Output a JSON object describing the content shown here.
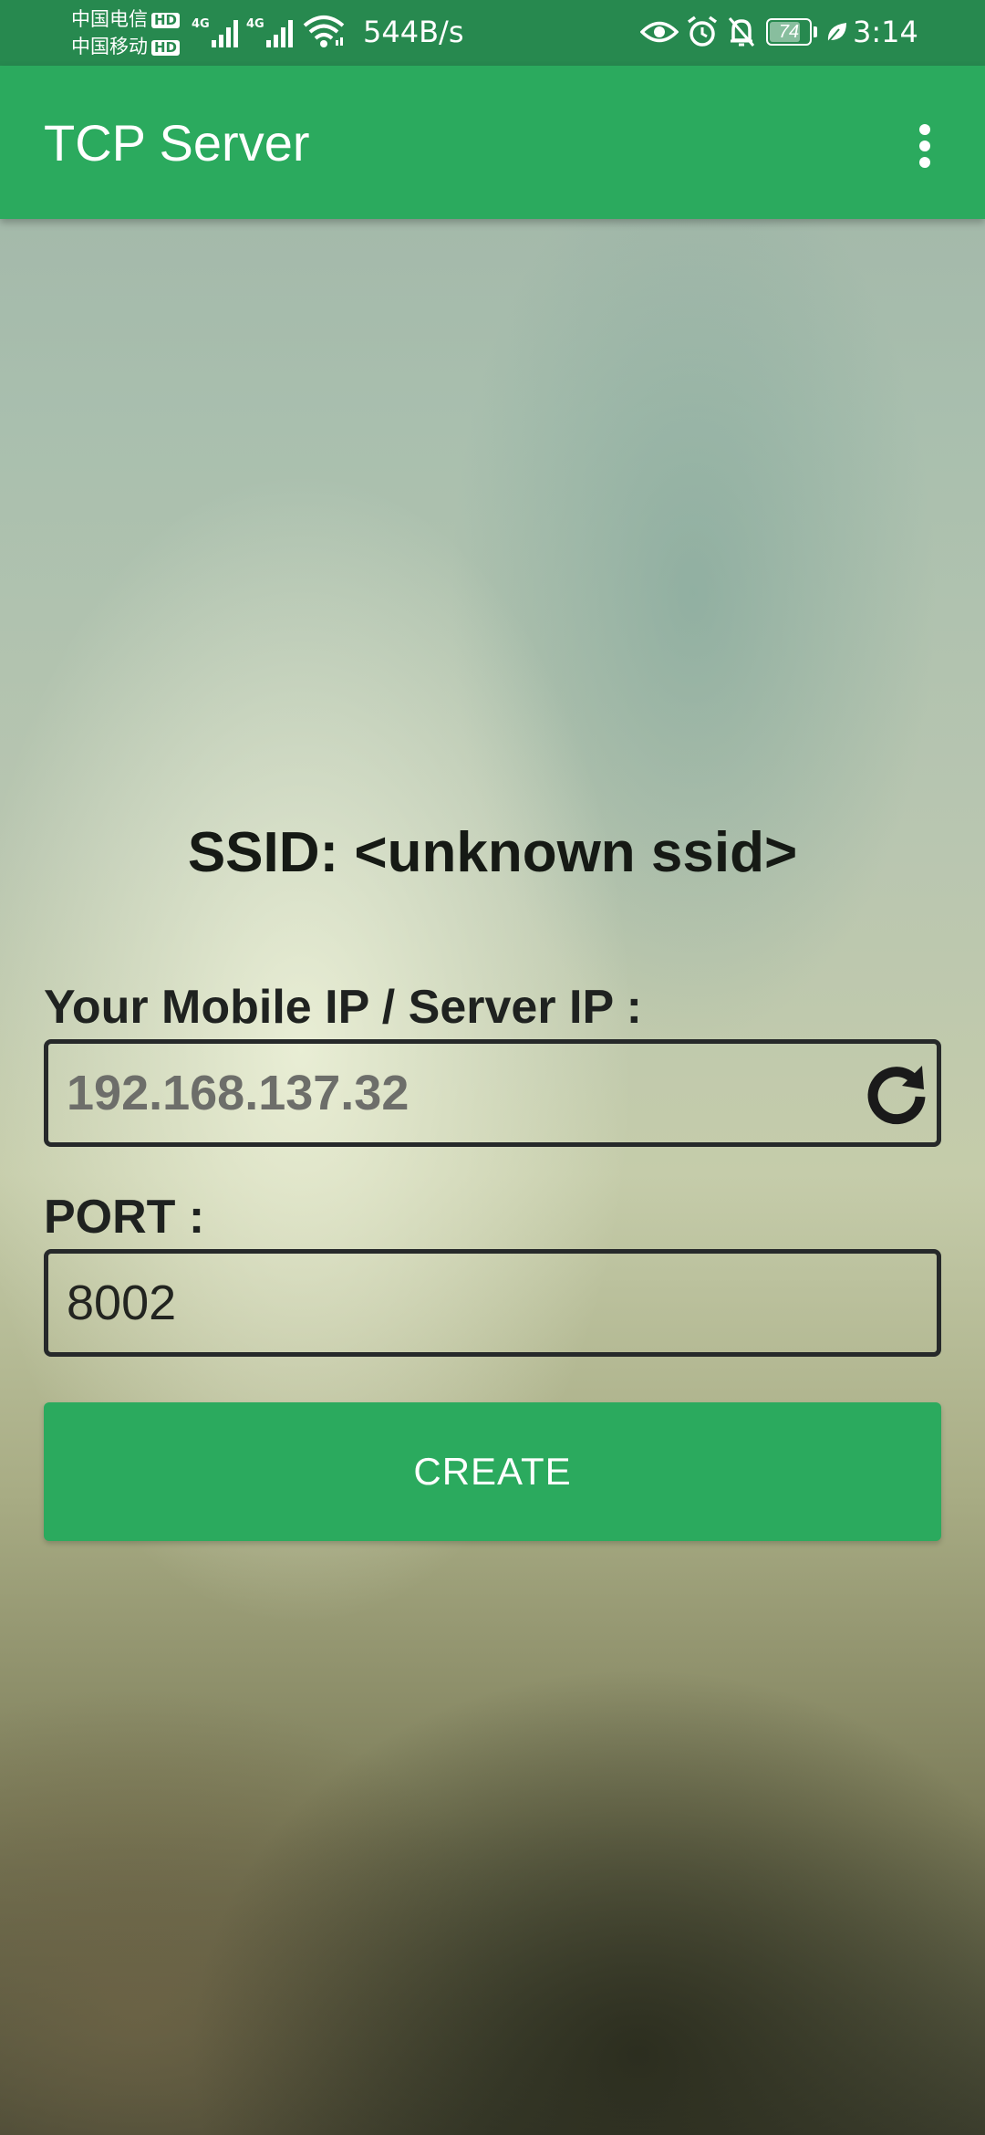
{
  "status_bar": {
    "carrier_1": "中国电信",
    "carrier_2": "中国移动",
    "hd_badge": "HD",
    "network_type": "4G",
    "net_speed": "544B/s",
    "battery_level": "74",
    "time": "3:14",
    "icons": [
      "eye-icon",
      "alarm-icon",
      "bell-muted-icon",
      "battery-icon",
      "leaf-icon"
    ]
  },
  "app_bar": {
    "title": "TCP Server",
    "menu_icon": "more-vert-icon"
  },
  "main": {
    "ssid_text": "SSID: <unknown ssid>",
    "ip_label": "Your Mobile IP / Server IP :",
    "ip_value": "192.168.137.32",
    "refresh_icon": "refresh-icon",
    "port_label": "PORT :",
    "port_value": "8002",
    "create_label": "CREATE"
  },
  "colors": {
    "status_bar": "#27894f",
    "app_bar": "#2baa5e",
    "button": "#2baa5e"
  }
}
